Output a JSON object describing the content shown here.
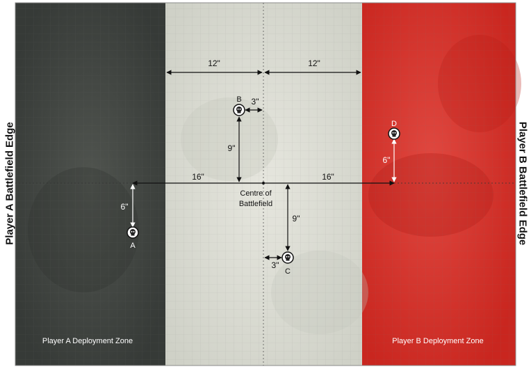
{
  "edges": {
    "player_a": "Player A Battlefield Edge",
    "player_b": "Player B Battlefield Edge"
  },
  "zones": {
    "player_a": "Player A Deployment Zone",
    "player_b": "Player B Deployment Zone"
  },
  "centre_label_line1": "Centre of",
  "centre_label_line2": "Battlefield",
  "objectives": [
    "A",
    "B",
    "C",
    "D"
  ],
  "measurements": {
    "top_left": "12\"",
    "top_right": "12\"",
    "b_side": "3\"",
    "b_vertical": "9\"",
    "mid_left": "16\"",
    "mid_right": "16\"",
    "a_vertical": "6\"",
    "c_vertical": "9\"",
    "c_side": "3\"",
    "d_vertical": "6\""
  },
  "colors": {
    "player_a_zone": "#3f4340",
    "no_mans_land": "#dcdcd4",
    "player_b_zone": "#d8332e"
  }
}
